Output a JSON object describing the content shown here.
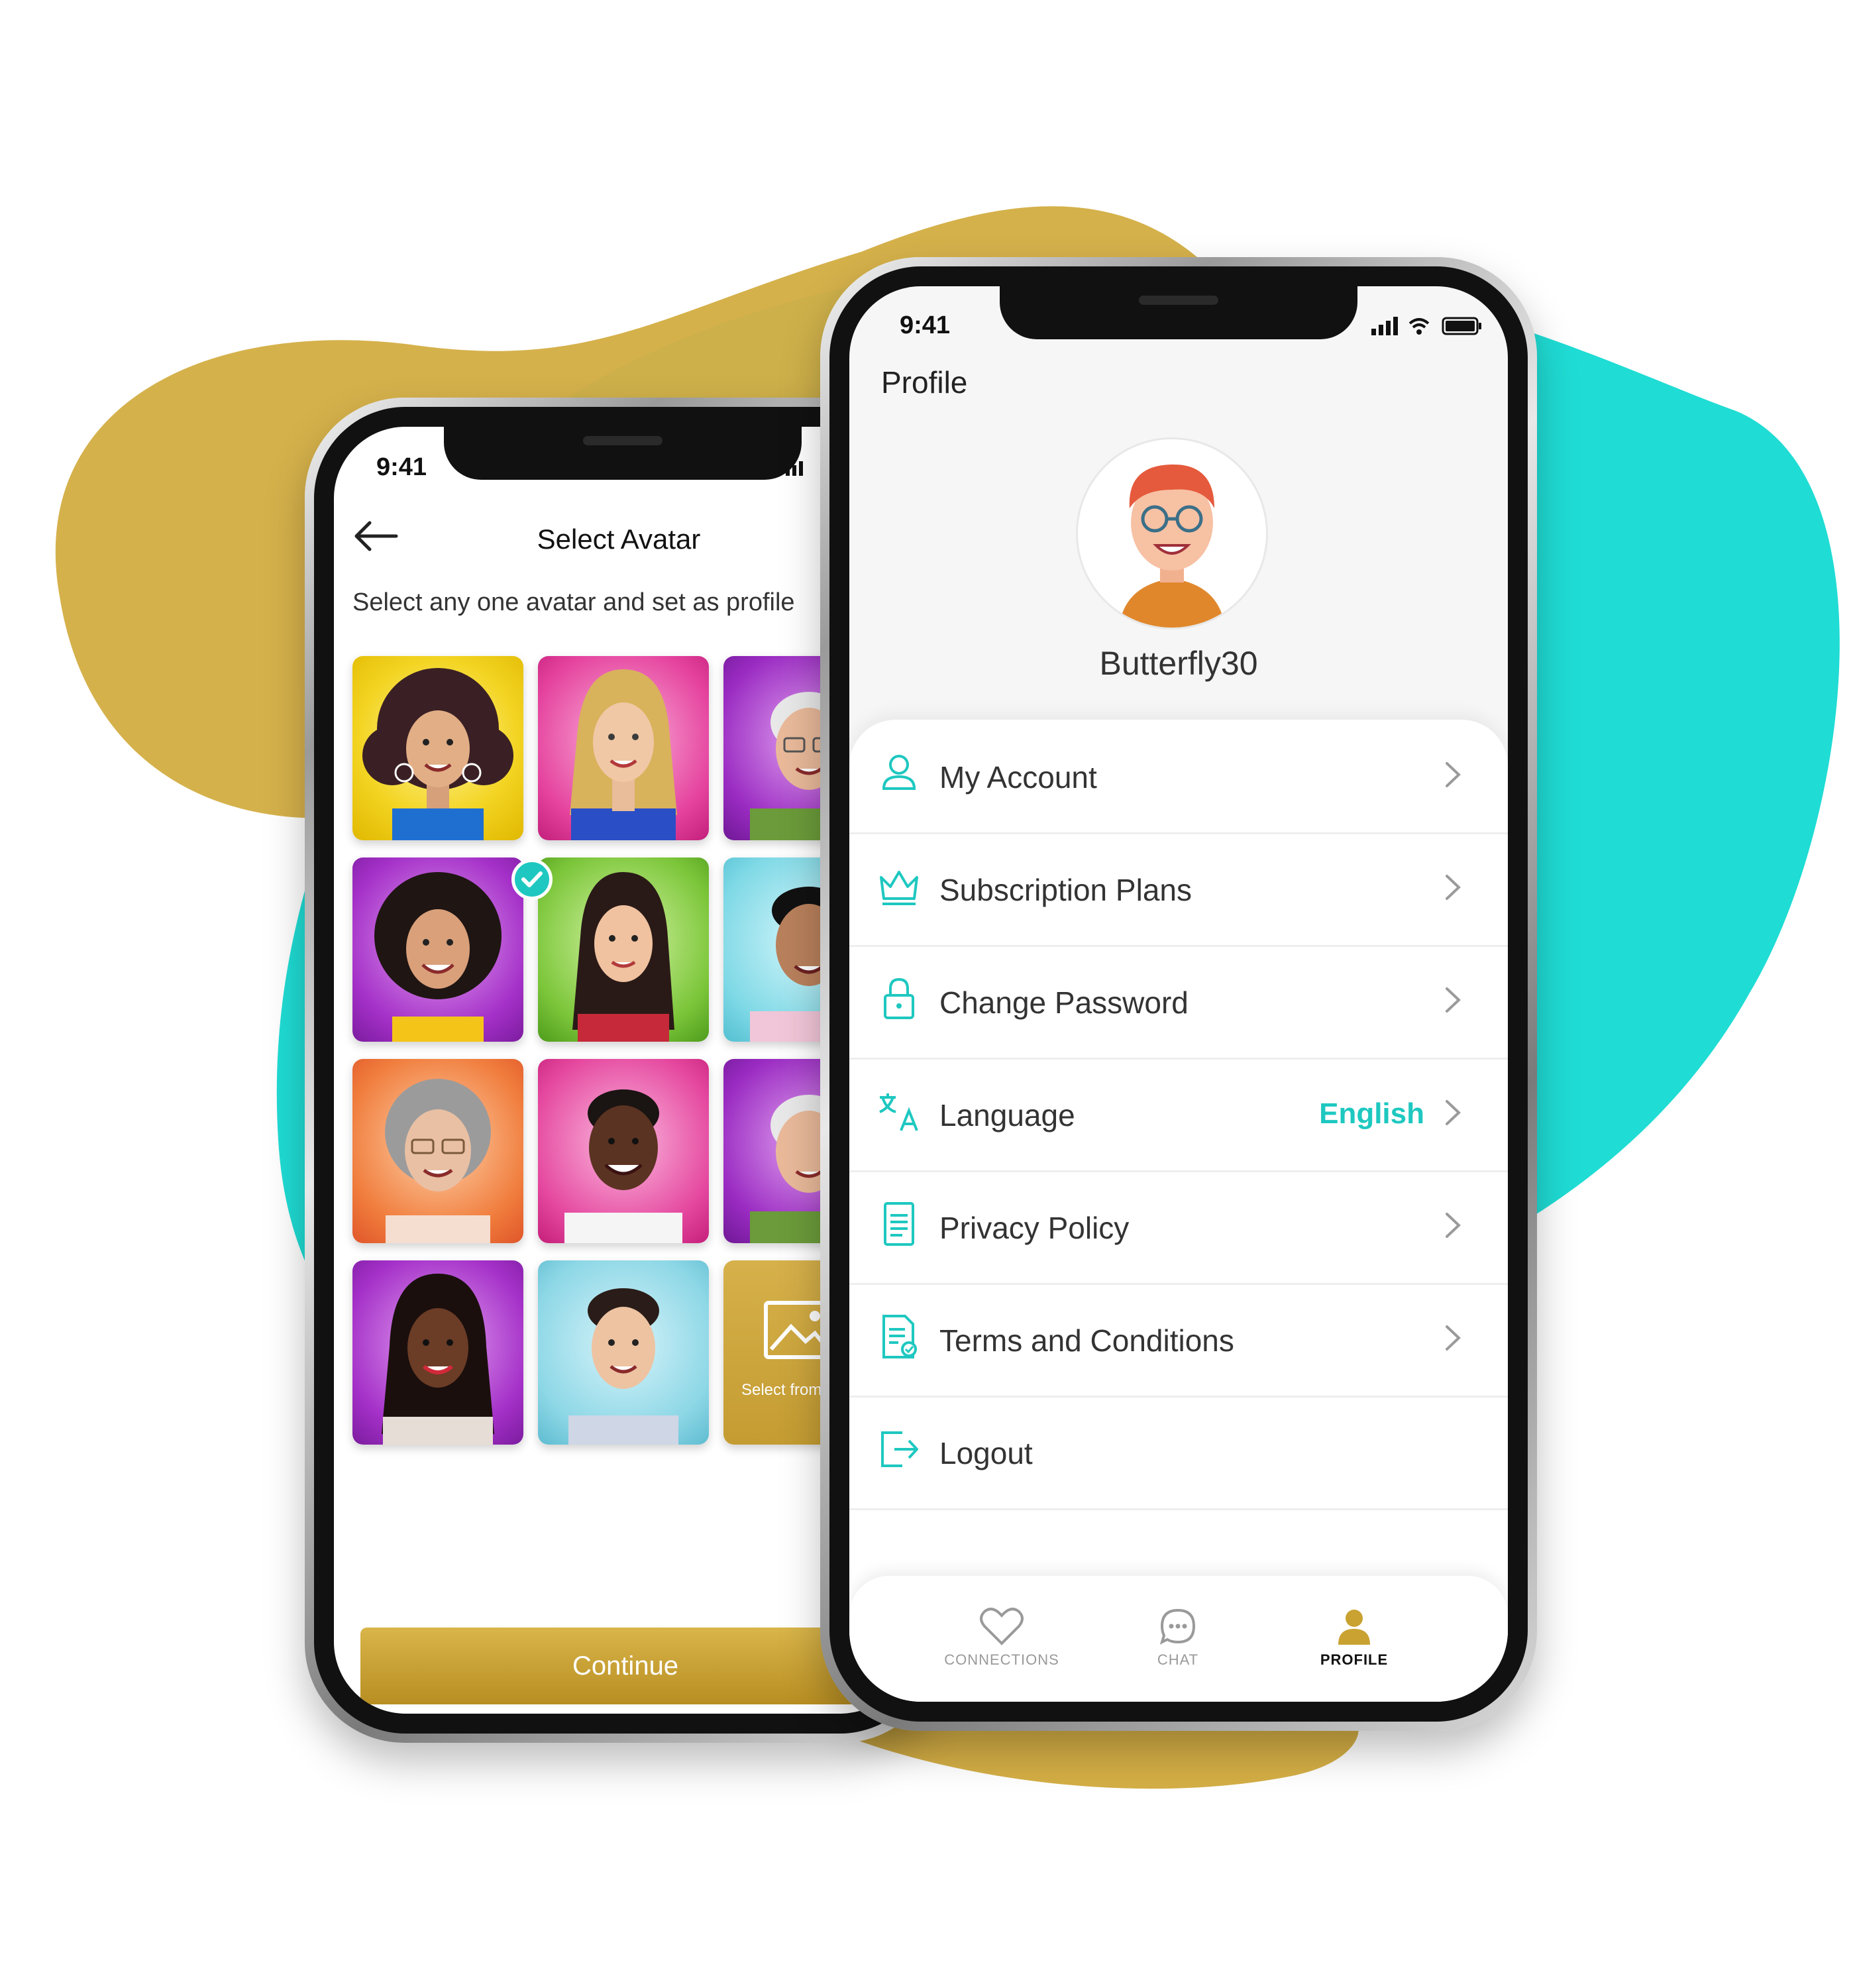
{
  "colors": {
    "gold": "#d4ae45",
    "teal": "#1fdcd4",
    "accent_teal": "#1ec8c0",
    "button_gold": "#c9a232"
  },
  "select_avatar_screen": {
    "status_time": "9:41",
    "title": "Select Avatar",
    "subtitle": "Select any one avatar and set as profile",
    "gallery_label": "Select from Gallery",
    "continue_label": "Continue",
    "avatars": [
      {
        "name": "avatar-curly-hair-woman",
        "selected": true
      },
      {
        "name": "avatar-blonde-woman",
        "selected": false
      },
      {
        "name": "avatar-older-man-glasses",
        "selected": false
      },
      {
        "name": "avatar-woman-dark-curly-hair",
        "selected": false
      },
      {
        "name": "avatar-young-woman-long-hair",
        "selected": false
      },
      {
        "name": "avatar-man-dark-hair",
        "selected": false
      },
      {
        "name": "avatar-grandmother-glasses",
        "selected": false
      },
      {
        "name": "avatar-smiling-man",
        "selected": false
      },
      {
        "name": "avatar-older-man-glasses-2",
        "selected": false
      },
      {
        "name": "avatar-woman-long-dark-hair",
        "selected": false
      },
      {
        "name": "avatar-young-man",
        "selected": false
      }
    ]
  },
  "profile_screen": {
    "status_time": "9:41",
    "title": "Profile",
    "username": "Butterfly30",
    "menu": [
      {
        "label": "My Account",
        "icon": "user-icon",
        "value": ""
      },
      {
        "label": "Subscription Plans",
        "icon": "crown-icon",
        "value": ""
      },
      {
        "label": "Change Password",
        "icon": "lock-icon",
        "value": ""
      },
      {
        "label": "Language",
        "icon": "translate-icon",
        "value": "English"
      },
      {
        "label": "Privacy Policy",
        "icon": "document-icon",
        "value": ""
      },
      {
        "label": "Terms and Conditions",
        "icon": "certificate-icon",
        "value": ""
      },
      {
        "label": "Logout",
        "icon": "logout-icon",
        "value": ""
      }
    ],
    "tabs": [
      {
        "label": "CONNECTIONS",
        "icon": "heart-icon",
        "active": false
      },
      {
        "label": "CHAT",
        "icon": "chat-icon",
        "active": false
      },
      {
        "label": "PROFILE",
        "icon": "person-icon",
        "active": true
      }
    ]
  }
}
